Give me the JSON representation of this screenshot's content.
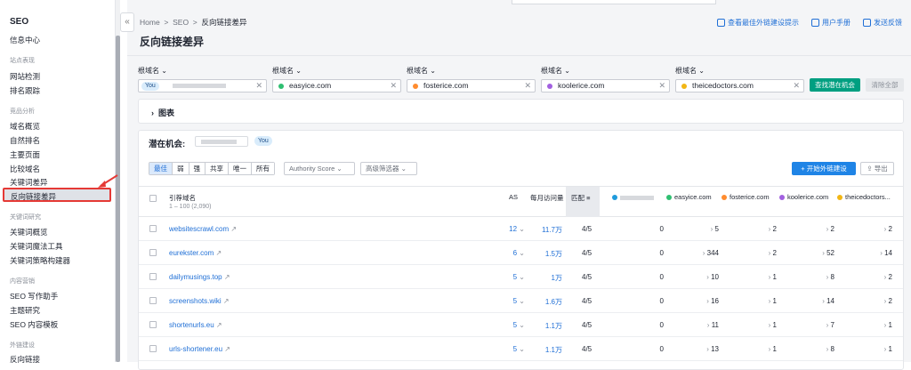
{
  "sidebar": {
    "title": "SEO",
    "info_center": "信息中心",
    "groups": [
      {
        "label": "站点表现",
        "items": [
          "网站检测",
          "排名跟踪"
        ]
      },
      {
        "label": "竞品分析",
        "items": [
          "域名概览",
          "自然排名",
          "主要页面",
          "比较域名",
          "关键词差异",
          "反向链接差异"
        ]
      },
      {
        "label": "关键词研究",
        "items": [
          "关键词概览",
          "关键词魔法工具",
          "关键词策略构建器"
        ]
      },
      {
        "label": "内容营销",
        "items": [
          "SEO 写作助手",
          "主题研究",
          "SEO 内容模板"
        ]
      },
      {
        "label": "外链建设",
        "items": [
          "反向链接"
        ]
      }
    ],
    "collapse_icon": "«"
  },
  "breadcrumb": [
    "Home",
    "SEO",
    "反向链接差异"
  ],
  "page_title": "反向链接差异",
  "header_links": [
    "查看最佳外链建设提示",
    "用户手册",
    "发送反馈"
  ],
  "filters": {
    "label": "根域名",
    "you_badge": "You",
    "domains": [
      {
        "name": "easyice.com",
        "color": "#2fbf71"
      },
      {
        "name": "fosterice.com",
        "color": "#ff8c2e"
      },
      {
        "name": "koolerice.com",
        "color": "#a260e0"
      },
      {
        "name": "theicedoctors.com",
        "color": "#f2b614"
      }
    ],
    "find_button": "查找潜在机会",
    "clear_button": "清除全部"
  },
  "chart_section": "图表",
  "opportunities": {
    "label": "潜在机会:",
    "you_badge": "You",
    "segments": [
      "最佳",
      "弱",
      "强",
      "共享",
      "唯一",
      "所有"
    ],
    "authority_dropdown": "Authority Score",
    "advanced_dropdown": "高级筛选器",
    "start_button": "+ 开始外链建设",
    "export_button": "导出"
  },
  "table": {
    "headers": {
      "domain": "引荐域名",
      "range": "1 – 100 (2,090)",
      "as": "AS",
      "visits": "每月访问量",
      "match": "匹配",
      "competitors": [
        "easyice.com",
        "fosterice.com",
        "koolerice.com",
        "theicedoctors..."
      ]
    },
    "you_color": "#1f9bdc",
    "rows": [
      {
        "domain": "websitescrawl.com",
        "as": "12",
        "visits": "11.7万",
        "match": "4/5",
        "you": "0",
        "c1": "5",
        "c2": "2",
        "c3": "2",
        "c4": "2"
      },
      {
        "domain": "eurekster.com",
        "as": "6",
        "visits": "1.5万",
        "match": "4/5",
        "you": "0",
        "c1": "344",
        "c2": "2",
        "c3": "52",
        "c4": "14"
      },
      {
        "domain": "dailymusings.top",
        "as": "5",
        "visits": "1万",
        "match": "4/5",
        "you": "0",
        "c1": "10",
        "c2": "1",
        "c3": "8",
        "c4": "2"
      },
      {
        "domain": "screenshots.wiki",
        "as": "5",
        "visits": "1.6万",
        "match": "4/5",
        "you": "0",
        "c1": "16",
        "c2": "1",
        "c3": "14",
        "c4": "2"
      },
      {
        "domain": "shortenurls.eu",
        "as": "5",
        "visits": "1.1万",
        "match": "4/5",
        "you": "0",
        "c1": "11",
        "c2": "1",
        "c3": "7",
        "c4": "1"
      },
      {
        "domain": "urls-shortener.eu",
        "as": "5",
        "visits": "1.1万",
        "match": "4/5",
        "you": "0",
        "c1": "13",
        "c2": "1",
        "c3": "8",
        "c4": "1"
      }
    ]
  }
}
